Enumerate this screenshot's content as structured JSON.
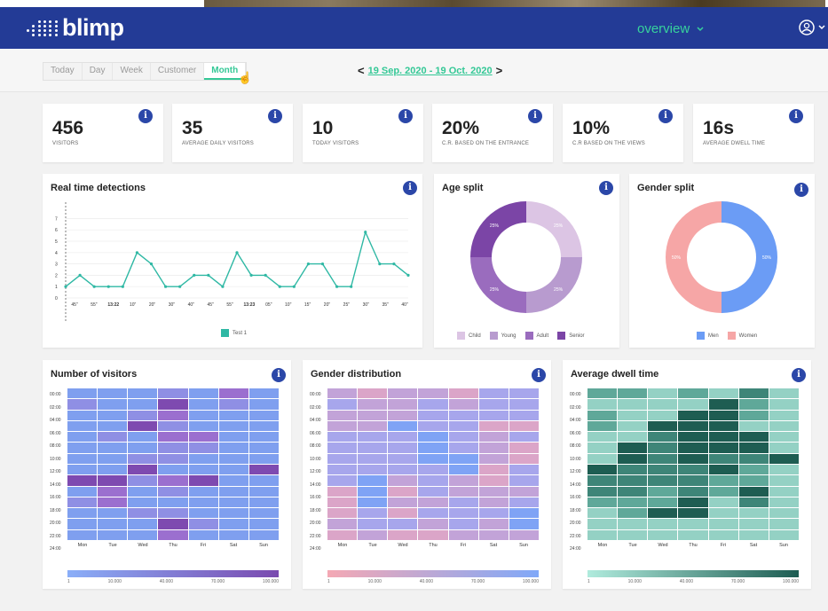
{
  "app": {
    "brand": "blimp",
    "nav_menu": "overview"
  },
  "periods": [
    {
      "label": "Today",
      "active": false
    },
    {
      "label": "Day",
      "active": false
    },
    {
      "label": "Week",
      "active": false
    },
    {
      "label": "Customer",
      "active": false
    },
    {
      "label": "Month",
      "active": true
    }
  ],
  "date_range": "19 Sep. 2020 - 19 Oct. 2020",
  "kpis": [
    {
      "value": "456",
      "label": "VISITORS"
    },
    {
      "value": "35",
      "label": "AVERAGE DAILY VISITORS"
    },
    {
      "value": "10",
      "label": "TODAY VISITORS"
    },
    {
      "value": "20%",
      "label": "C.R. BASED ON THE ENTRANCE"
    },
    {
      "value": "10%",
      "label": "C.R BASED ON THE VIEWS"
    },
    {
      "value": "16s",
      "label": "AVERAGE DWELL TIME"
    }
  ],
  "realtime": {
    "title": "Real time detections",
    "chart_data": {
      "type": "line",
      "x": [
        "45\"",
        "55\"",
        "13:22",
        "10\"",
        "20\"",
        "30\"",
        "40\"",
        "45\"",
        "55\"",
        "13:23",
        "05\"",
        "10\"",
        "15\"",
        "20\"",
        "25\"",
        "30\"",
        "35\"",
        "40\""
      ],
      "series": [
        {
          "name": "Test 1",
          "values": [
            1,
            2,
            1,
            1,
            1,
            4,
            3,
            1,
            1,
            2,
            2,
            1,
            4,
            2,
            2,
            1,
            1,
            3,
            3,
            1,
            1,
            5.8,
            3,
            3,
            2
          ]
        }
      ],
      "yticks": [
        "0",
        "1",
        "2",
        "3",
        "4",
        "5",
        "6",
        "7"
      ],
      "ylim": [
        0,
        7.5
      ],
      "color": "#2fb8a4"
    }
  },
  "age_split": {
    "title": "Age split",
    "chart_data": {
      "type": "pie",
      "categories": [
        "Child",
        "Young",
        "Adult",
        "Senior"
      ],
      "values": [
        25,
        25,
        25,
        25
      ],
      "labels": [
        "25%",
        "25%",
        "25%",
        "25%"
      ],
      "colors": [
        "#dcc5e4",
        "#b89bcf",
        "#9a6cbe",
        "#7b45a6"
      ]
    }
  },
  "gender_split": {
    "title": "Gender split",
    "chart_data": {
      "type": "pie",
      "categories": [
        "Men",
        "Women"
      ],
      "values": [
        50,
        50
      ],
      "labels": [
        "50%",
        "50%"
      ],
      "colors": [
        "#6b9cf5",
        "#f6a6a6"
      ]
    }
  },
  "heatmaps": [
    {
      "title": "Number of visitors",
      "palette": [
        "#9db6f7",
        "#7f9fef",
        "#8f8fe4",
        "#9b6fcf",
        "#7e4ab0"
      ],
      "scale_colors": [
        "#8aaef8",
        "#7a4aaf"
      ],
      "cells": [
        [
          1,
          1,
          1,
          2,
          1,
          3,
          1
        ],
        [
          2,
          1,
          1,
          4,
          1,
          2,
          1
        ],
        [
          1,
          1,
          2,
          3,
          1,
          1,
          1
        ],
        [
          1,
          1,
          4,
          2,
          1,
          1,
          1
        ],
        [
          1,
          2,
          1,
          3,
          3,
          1,
          1
        ],
        [
          1,
          1,
          1,
          2,
          2,
          1,
          1
        ],
        [
          1,
          1,
          2,
          2,
          1,
          1,
          1
        ],
        [
          1,
          1,
          4,
          1,
          1,
          1,
          4
        ],
        [
          4,
          4,
          2,
          3,
          4,
          1,
          1
        ],
        [
          1,
          3,
          1,
          2,
          1,
          1,
          1
        ],
        [
          2,
          3,
          1,
          1,
          1,
          1,
          1
        ],
        [
          1,
          1,
          2,
          2,
          1,
          1,
          1
        ],
        [
          1,
          1,
          1,
          4,
          2,
          1,
          1
        ],
        [
          1,
          1,
          1,
          3,
          1,
          1,
          1
        ]
      ]
    },
    {
      "title": "Gender distribution",
      "palette": [
        "#f0a8b5",
        "#dba5c8",
        "#c2a3d8",
        "#a7a6ec",
        "#7fa3f5"
      ],
      "scale_colors": [
        "#f4a8b4",
        "#80a8f8"
      ],
      "cells": [
        [
          2,
          1,
          2,
          2,
          1,
          3,
          3
        ],
        [
          3,
          2,
          2,
          3,
          2,
          3,
          3
        ],
        [
          2,
          2,
          2,
          3,
          3,
          3,
          3
        ],
        [
          2,
          2,
          4,
          3,
          3,
          1,
          1
        ],
        [
          3,
          3,
          3,
          4,
          3,
          2,
          3
        ],
        [
          3,
          3,
          3,
          4,
          3,
          2,
          1
        ],
        [
          3,
          3,
          3,
          4,
          4,
          2,
          1
        ],
        [
          3,
          3,
          3,
          3,
          4,
          1,
          3
        ],
        [
          3,
          4,
          2,
          3,
          2,
          1,
          3
        ],
        [
          1,
          4,
          1,
          3,
          2,
          2,
          2
        ],
        [
          1,
          4,
          2,
          2,
          3,
          2,
          3
        ],
        [
          1,
          3,
          1,
          3,
          3,
          3,
          4
        ],
        [
          2,
          3,
          3,
          2,
          3,
          2,
          4
        ],
        [
          1,
          2,
          1,
          1,
          2,
          2,
          2
        ]
      ]
    },
    {
      "title": "Average dwell time",
      "palette": [
        "#b3e8de",
        "#94d1c4",
        "#5fa899",
        "#3e8578",
        "#1e5d52"
      ],
      "scale_colors": [
        "#b0ebdd",
        "#1d5c52"
      ],
      "cells": [
        [
          2,
          2,
          1,
          2,
          1,
          3,
          1
        ],
        [
          1,
          1,
          1,
          1,
          4,
          2,
          1
        ],
        [
          2,
          1,
          1,
          4,
          4,
          2,
          1
        ],
        [
          2,
          1,
          4,
          4,
          4,
          1,
          1
        ],
        [
          1,
          1,
          3,
          4,
          4,
          4,
          1
        ],
        [
          1,
          4,
          3,
          4,
          4,
          4,
          1
        ],
        [
          1,
          4,
          3,
          4,
          3,
          3,
          4
        ],
        [
          4,
          3,
          3,
          3,
          4,
          2,
          1
        ],
        [
          3,
          3,
          3,
          3,
          2,
          2,
          1
        ],
        [
          3,
          3,
          2,
          3,
          2,
          4,
          1
        ],
        [
          2,
          2,
          2,
          4,
          1,
          3,
          1
        ],
        [
          1,
          2,
          4,
          4,
          1,
          1,
          1
        ],
        [
          1,
          1,
          1,
          1,
          1,
          1,
          1
        ],
        [
          1,
          1,
          1,
          1,
          1,
          1,
          1
        ]
      ]
    }
  ],
  "heatmap_rows": [
    "00:00",
    "02:00",
    "04:00",
    "06:00",
    "08:00",
    "10:00",
    "12:00",
    "14:00",
    "16:00",
    "18:00",
    "20:00",
    "22:00",
    "24:00"
  ],
  "heatmap_days": [
    "Mon",
    "Tue",
    "Wed",
    "Thu",
    "Fri",
    "Sat",
    "Sun"
  ],
  "heatmap_scale": [
    "1",
    "10.000",
    "40.000",
    "70.000",
    "100.000"
  ],
  "icons": {
    "info": "i"
  }
}
